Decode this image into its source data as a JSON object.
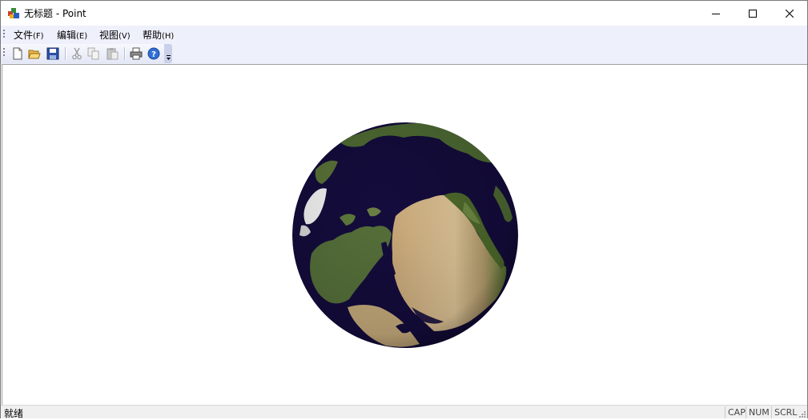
{
  "window": {
    "title": "无标题 - Point"
  },
  "menubar": {
    "items": [
      {
        "label": "文件",
        "accel": "(F)"
      },
      {
        "label": "编辑",
        "accel": "(E)"
      },
      {
        "label": "视图",
        "accel": "(V)"
      },
      {
        "label": "帮助",
        "accel": "(H)"
      }
    ]
  },
  "toolbar": {
    "buttons": [
      "new-icon",
      "open-icon",
      "save-icon",
      "cut-icon",
      "copy-icon",
      "paste-icon",
      "print-icon",
      "help-icon"
    ]
  },
  "statusbar": {
    "status": "就绪",
    "indicators": [
      "CAP",
      "NUM",
      "SCRL"
    ]
  },
  "colors": {
    "menubar_bg": "#eef1fb",
    "ocean": "#140c3c",
    "land_desert": "#d9bb8a",
    "land_green": "#4d6b2e"
  }
}
